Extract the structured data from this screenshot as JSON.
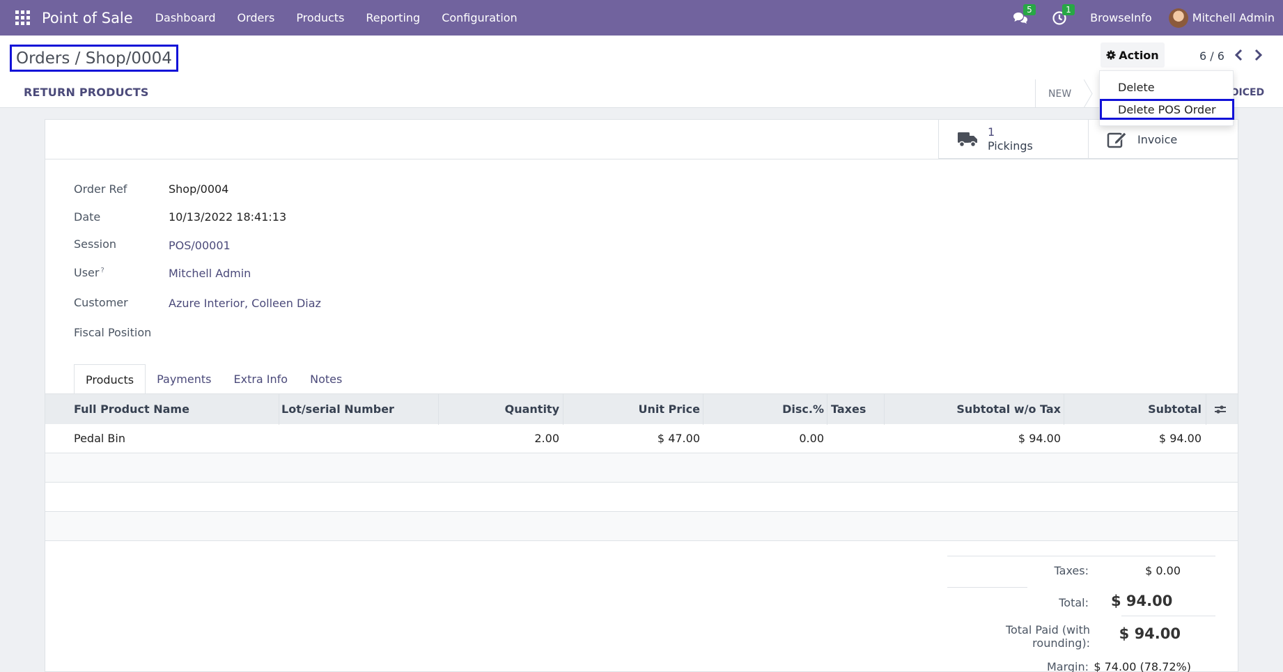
{
  "navbar": {
    "app_name": "Point of Sale",
    "menu": [
      "Dashboard",
      "Orders",
      "Products",
      "Reporting",
      "Configuration"
    ],
    "messages_count": "5",
    "activities_count": "1",
    "company": "BrowseInfo",
    "user": "Mitchell Admin"
  },
  "control": {
    "breadcrumb": "Orders / Shop/0004",
    "action_label": "Action",
    "pager": "6 / 6",
    "return_label": "RETURN PRODUCTS",
    "status_new": "NEW",
    "status_invoiced": "VOICED"
  },
  "dropdown": {
    "items": [
      "Delete",
      "Delete POS Order"
    ]
  },
  "smart_buttons": {
    "pickings_value": "1",
    "pickings_label": "Pickings",
    "invoice_label": "Invoice"
  },
  "fields": {
    "order_ref_label": "Order Ref",
    "order_ref": "Shop/0004",
    "date_label": "Date",
    "date": "10/13/2022 18:41:13",
    "session_label": "Session",
    "session": "POS/00001",
    "user_label": "User",
    "user_help": "?",
    "user": "Mitchell Admin",
    "customer_label": "Customer",
    "customer": "Azure Interior, Colleen Diaz",
    "fiscal_label": "Fiscal Position"
  },
  "tabs": [
    "Products",
    "Payments",
    "Extra Info",
    "Notes"
  ],
  "table": {
    "headers": [
      "Full Product Name",
      "Lot/serial Number",
      "Quantity",
      "Unit Price",
      "Disc.%",
      "Taxes",
      "Subtotal w/o Tax",
      "Subtotal"
    ],
    "rows": [
      [
        "Pedal Bin",
        "",
        "2.00",
        "$ 47.00",
        "0.00",
        "",
        "$ 94.00",
        "$ 94.00"
      ]
    ]
  },
  "totals": {
    "taxes_label": "Taxes:",
    "taxes": "$ 0.00",
    "total_label": "Total:",
    "total": "$ 94.00",
    "paid_label": "Total Paid (with rounding):",
    "paid": "$ 94.00",
    "margin_label": "Margin:",
    "margin": "$ 74.00 (78.72%)"
  }
}
